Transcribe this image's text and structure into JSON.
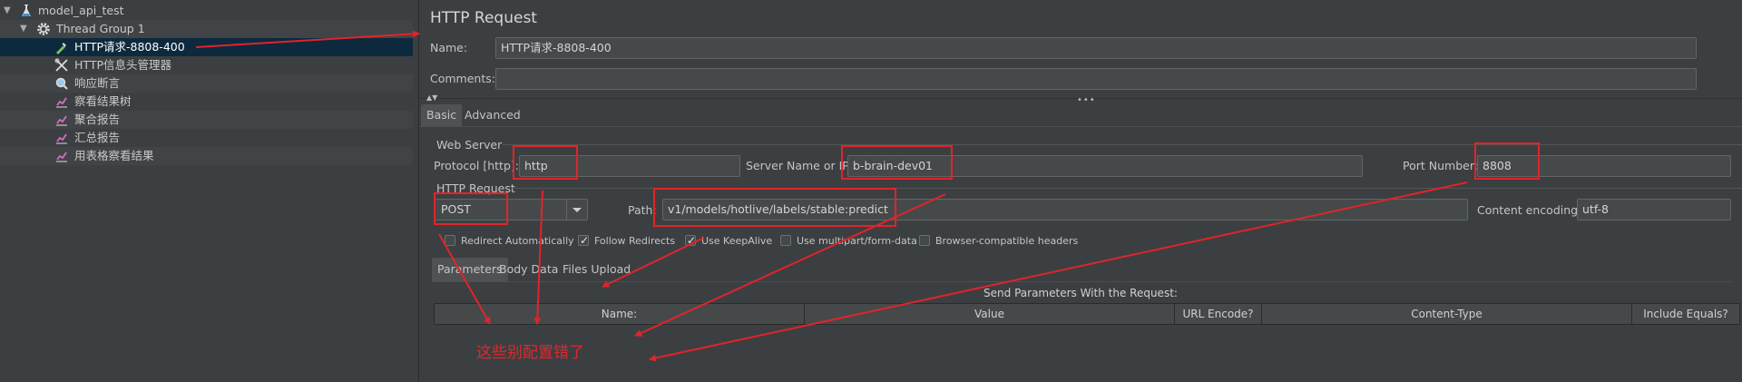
{
  "tree": {
    "items": [
      {
        "label": "model_api_test",
        "icon": "flask-icon",
        "toggle": "▼"
      },
      {
        "label": "Thread Group 1",
        "icon": "gear-icon",
        "toggle": "▼"
      },
      {
        "label": "HTTP请求-8808-400",
        "icon": "pipette-icon"
      },
      {
        "label": "HTTP信息头管理器",
        "icon": "wrench-icon"
      },
      {
        "label": "响应断言",
        "icon": "magnifier-icon"
      },
      {
        "label": "察看结果树",
        "icon": "graph-icon"
      },
      {
        "label": "聚合报告",
        "icon": "graph-icon"
      },
      {
        "label": "汇总报告",
        "icon": "graph-icon"
      },
      {
        "label": "用表格察看结果",
        "icon": "graph-icon"
      }
    ]
  },
  "panel": {
    "title": "HTTP Request",
    "name_label": "Name:",
    "name_value": "HTTP请求-8808-400",
    "comments_label": "Comments:",
    "comments_value": "",
    "tabs": [
      "Basic",
      "Advanced"
    ],
    "web_server": {
      "group_label": "Web Server",
      "protocol_label": "Protocol [http]:",
      "protocol_value": "http",
      "server_label": "Server Name or IP:",
      "server_value": "b-brain-dev01",
      "port_label": "Port Number:",
      "port_value": "8808"
    },
    "http_request": {
      "group_label": "HTTP Request",
      "method": "POST",
      "path_label": "Path:",
      "path_value": "v1/models/hotlive/labels/stable:predict",
      "encoding_label": "Content encoding:",
      "encoding_value": "utf-8"
    },
    "checkboxes": [
      {
        "label": "Redirect Automatically",
        "checked": false
      },
      {
        "label": "Follow Redirects",
        "checked": true
      },
      {
        "label": "Use KeepAlive",
        "checked": true
      },
      {
        "label": "Use multipart/form-data",
        "checked": false
      },
      {
        "label": "Browser-compatible headers",
        "checked": false
      }
    ],
    "param_tabs": [
      "Parameters",
      "Body Data",
      "Files Upload"
    ],
    "table": {
      "caption": "Send Parameters With the Request:",
      "columns": [
        "Name:",
        "Value",
        "URL Encode?",
        "Content-Type",
        "Include Equals?"
      ]
    }
  },
  "annotation": {
    "note": "这些别配置错了",
    "color": "#e2262c"
  },
  "colors": {
    "background": "#3c3f41",
    "selected_row": "#0d293e",
    "field_bg": "#45494a"
  }
}
